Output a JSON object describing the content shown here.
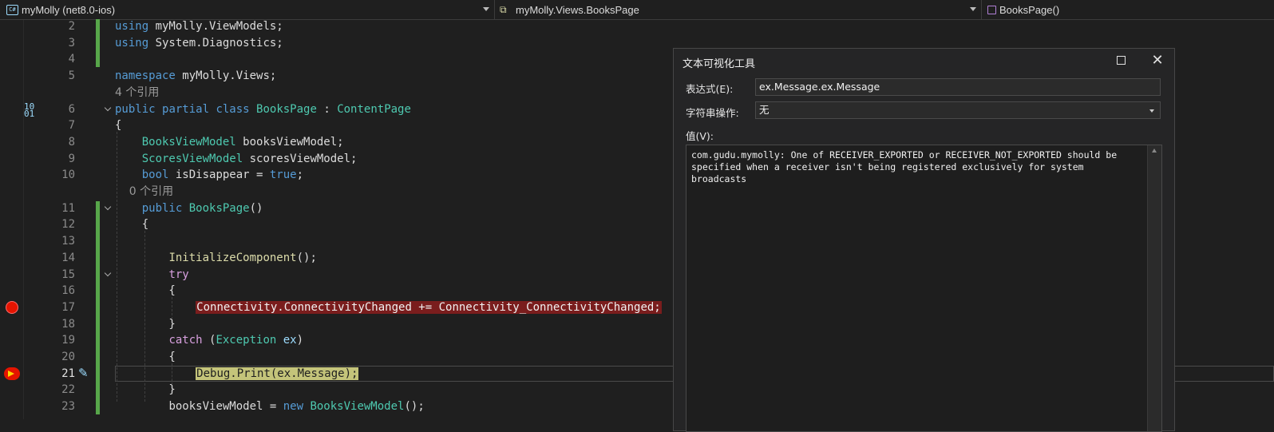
{
  "navbar": {
    "project": "myMolly (net8.0-ios)",
    "namespace": "myMolly.Views.BooksPage",
    "member": "BooksPage()"
  },
  "editor": {
    "lines": [
      {
        "n": "2",
        "parts": [
          {
            "t": "using ",
            "c": "kw"
          },
          {
            "t": "myMolly.ViewModels;",
            "c": "id"
          }
        ]
      },
      {
        "n": "3",
        "parts": [
          {
            "t": "using ",
            "c": "kw"
          },
          {
            "t": "System.Diagnostics;",
            "c": "id"
          }
        ]
      },
      {
        "n": "4",
        "parts": []
      },
      {
        "n": "5",
        "parts": [
          {
            "t": "namespace ",
            "c": "kw"
          },
          {
            "t": "myMolly.Views;",
            "c": "id"
          }
        ]
      },
      {
        "n": "",
        "ref": "4 个引用"
      },
      {
        "n": "6",
        "parts": [
          {
            "t": "public ",
            "c": "kw"
          },
          {
            "t": "partial ",
            "c": "kw"
          },
          {
            "t": "class ",
            "c": "kw"
          },
          {
            "t": "BooksPage",
            "c": "ty"
          },
          {
            "t": " : ",
            "c": "id"
          },
          {
            "t": "ContentPage",
            "c": "ty"
          }
        ]
      },
      {
        "n": "7",
        "parts": [
          {
            "t": "{",
            "c": "id"
          }
        ]
      },
      {
        "n": "8",
        "parts": [
          {
            "t": "    ",
            "c": "id"
          },
          {
            "t": "BooksViewModel",
            "c": "ty"
          },
          {
            "t": " booksViewModel;",
            "c": "id"
          }
        ]
      },
      {
        "n": "9",
        "parts": [
          {
            "t": "    ",
            "c": "id"
          },
          {
            "t": "ScoresViewModel",
            "c": "ty"
          },
          {
            "t": " scoresViewModel;",
            "c": "id"
          }
        ]
      },
      {
        "n": "10",
        "parts": [
          {
            "t": "    ",
            "c": "id"
          },
          {
            "t": "bool",
            "c": "kw"
          },
          {
            "t": " isDisappear = ",
            "c": "id"
          },
          {
            "t": "true",
            "c": "kw"
          },
          {
            "t": ";",
            "c": "id"
          }
        ]
      },
      {
        "n": "",
        "ref": "    0 个引用"
      },
      {
        "n": "11",
        "parts": [
          {
            "t": "    ",
            "c": "id"
          },
          {
            "t": "public ",
            "c": "kw"
          },
          {
            "t": "BooksPage",
            "c": "ty"
          },
          {
            "t": "()",
            "c": "id"
          }
        ]
      },
      {
        "n": "12",
        "parts": [
          {
            "t": "    {",
            "c": "id"
          }
        ]
      },
      {
        "n": "13",
        "parts": []
      },
      {
        "n": "14",
        "parts": [
          {
            "t": "        ",
            "c": "id"
          },
          {
            "t": "InitializeComponent",
            "c": "mt"
          },
          {
            "t": "();",
            "c": "id"
          }
        ]
      },
      {
        "n": "15",
        "parts": [
          {
            "t": "        ",
            "c": "id"
          },
          {
            "t": "try",
            "c": "kw2"
          }
        ]
      },
      {
        "n": "16",
        "parts": [
          {
            "t": "        {",
            "c": "id"
          }
        ]
      },
      {
        "n": "17",
        "parts": [
          {
            "t": "            ",
            "c": "id"
          },
          {
            "t": "Connectivity.ConnectivityChanged += Connectivity_ConnectivityChanged;",
            "c": "bp-hl"
          }
        ]
      },
      {
        "n": "18",
        "parts": [
          {
            "t": "        }",
            "c": "id"
          }
        ]
      },
      {
        "n": "19",
        "parts": [
          {
            "t": "        ",
            "c": "id"
          },
          {
            "t": "catch",
            "c": "kw2"
          },
          {
            "t": " (",
            "c": "id"
          },
          {
            "t": "Exception",
            "c": "ty"
          },
          {
            "t": " ",
            "c": "id"
          },
          {
            "t": "ex",
            "c": "pa"
          },
          {
            "t": ")",
            "c": "id"
          }
        ]
      },
      {
        "n": "20",
        "parts": [
          {
            "t": "        {",
            "c": "id"
          }
        ]
      },
      {
        "n": "21",
        "parts": [
          {
            "t": "            ",
            "c": "id"
          },
          {
            "t": "Debug.Print(ex.Message);",
            "c": "cur-hl"
          }
        ]
      },
      {
        "n": "22",
        "parts": [
          {
            "t": "        }",
            "c": "id"
          }
        ]
      },
      {
        "n": "23",
        "parts": [
          {
            "t": "        ",
            "c": "id"
          },
          {
            "t": "booksViewModel = ",
            "c": "id"
          },
          {
            "t": "new ",
            "c": "kw"
          },
          {
            "t": "BooksViewModel",
            "c": "ty"
          },
          {
            "t": "();",
            "c": "id"
          }
        ]
      }
    ]
  },
  "dialog": {
    "title": "文本可视化工具",
    "expression_label": "表达式(E):",
    "expression_value": "ex.Message.ex.Message",
    "string_op_label": "字符串操作:",
    "string_op_value": "无",
    "value_label": "值(V):",
    "value_text": "com.gudu.mymolly: One of RECEIVER_EXPORTED or RECEIVER_NOT_EXPORTED should be specified when a receiver isn't being registered exclusively for system broadcasts"
  }
}
